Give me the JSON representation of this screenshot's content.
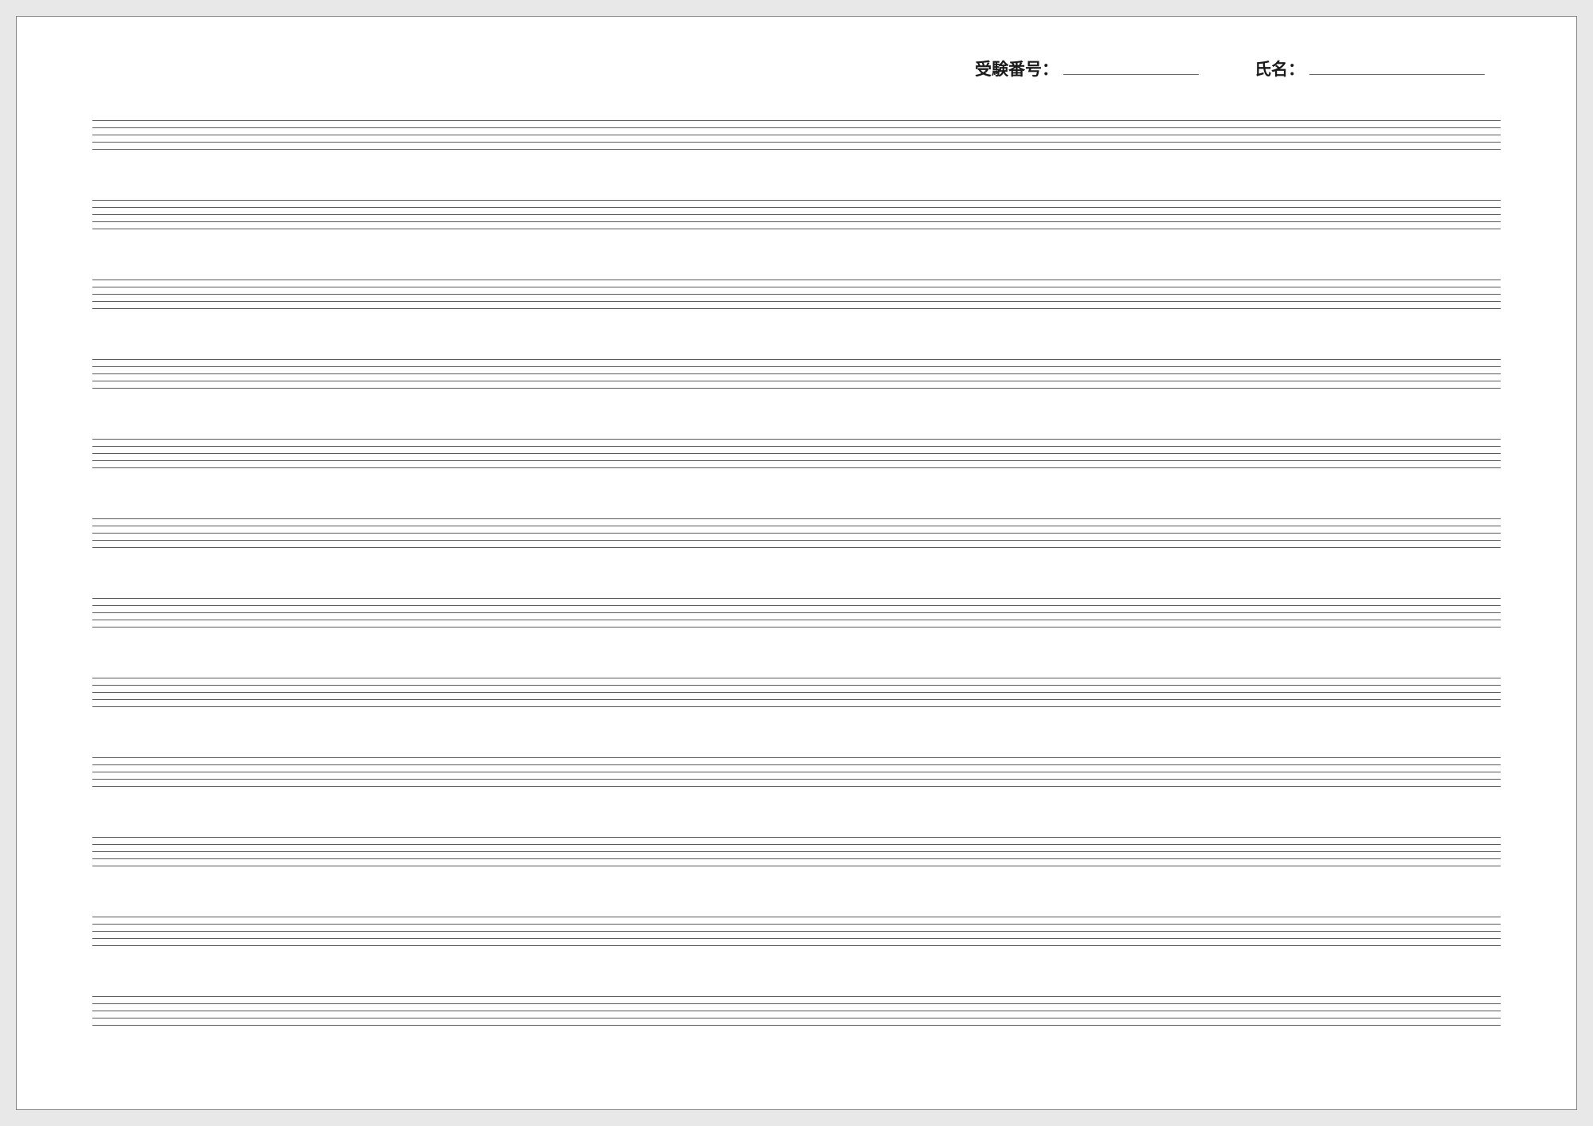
{
  "header": {
    "exam_number_label": "受験番号：",
    "name_label": "氏名：",
    "exam_number_value": "",
    "name_value": ""
  },
  "staves": {
    "count": 12,
    "lines_per_staff": 5
  }
}
